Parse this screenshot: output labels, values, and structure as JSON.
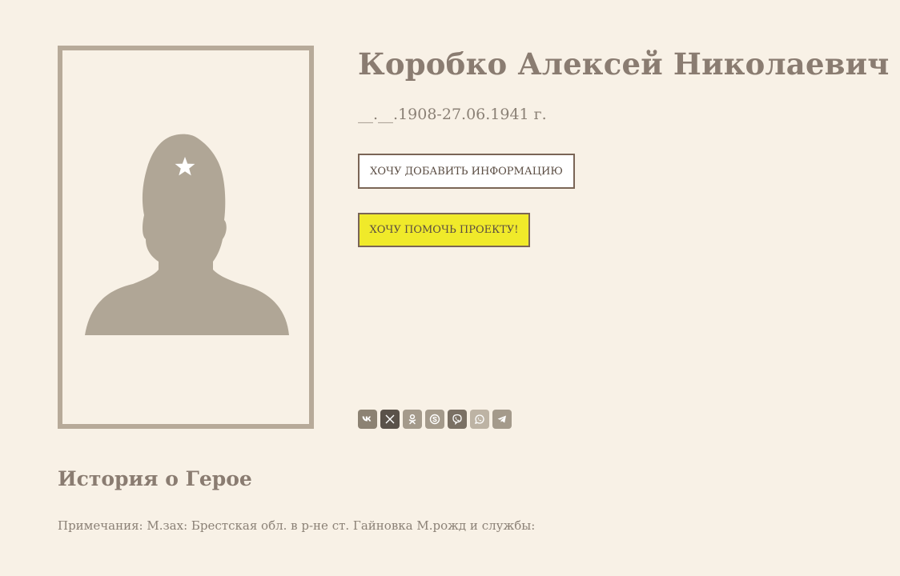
{
  "hero": {
    "name": "Коробко Алексей Николаевич",
    "dates": "__.__.1908-27.06.1941 г."
  },
  "buttons": {
    "add_info": "ХОЧУ ДОБАВИТЬ ИНФОРМАЦИЮ",
    "help_project": "ХОЧУ ПОМОЧЬ ПРОЕКТУ!"
  },
  "share": {
    "items": [
      {
        "icon": "vk-icon",
        "color": "#8c8273"
      },
      {
        "icon": "x-icon",
        "color": "#5a524a"
      },
      {
        "icon": "odnoklassniki-icon",
        "color": "#a49a8b"
      },
      {
        "icon": "skype-icon",
        "color": "#a49a8b"
      },
      {
        "icon": "viber-icon",
        "color": "#7a7064"
      },
      {
        "icon": "whatsapp-icon",
        "color": "#bdb3a4"
      },
      {
        "icon": "telegram-icon",
        "color": "#a49a8b"
      }
    ]
  },
  "story": {
    "title": "История о Герое",
    "note": "Примечания: М.зах: Брестская обл. в р-не ст. Гайновка М.рожд и службы:"
  },
  "colors": {
    "background": "#f8f1e6",
    "frame": "#b7aa99",
    "silhouette": "#b0a696",
    "help_button": "#f0ea2a"
  }
}
